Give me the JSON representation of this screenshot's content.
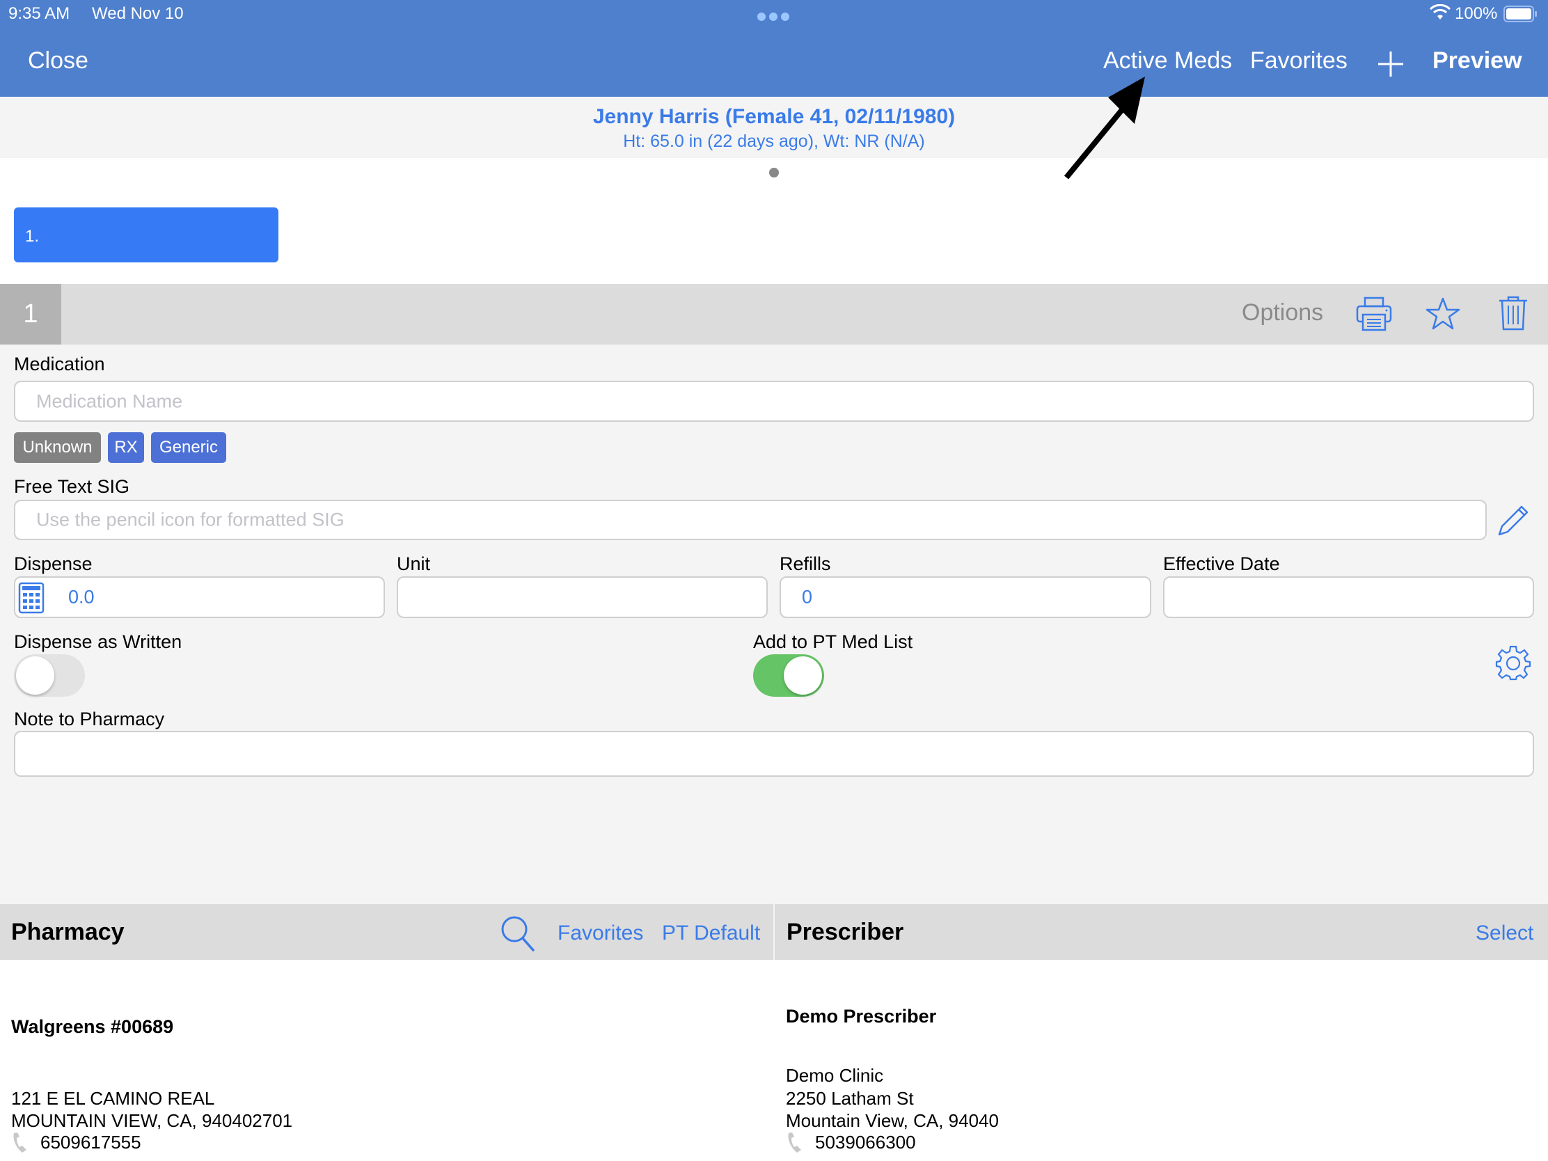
{
  "status_bar": {
    "time": "9:35 AM",
    "date": "Wed Nov 10",
    "battery": "100%"
  },
  "nav": {
    "close_label": "Close",
    "active_meds_label": "Active Meds",
    "favorites_label": "Favorites",
    "add_icon": "plus-icon",
    "preview_label": "Preview"
  },
  "patient": {
    "name_line": "Jenny Harris (Female 41, 02/11/1980)",
    "vitals_line": "Ht: 65.0 in (22 days ago), Wt: NR  (N/A)"
  },
  "rx_tab": {
    "label": "1."
  },
  "section": {
    "number": "1",
    "options_label": "Options",
    "icons": [
      "printer-icon",
      "star-icon",
      "trash-icon"
    ]
  },
  "form": {
    "medication_label": "Medication",
    "medication_placeholder": "Medication Name",
    "medication_value": "",
    "badges": [
      {
        "label": "Unknown",
        "color": "#828282"
      },
      {
        "label": "RX",
        "color": "#4c70d6"
      },
      {
        "label": "Generic",
        "color": "#4c70d6"
      }
    ],
    "sig_label": "Free Text SIG",
    "sig_placeholder": "Use the pencil icon for formatted SIG",
    "sig_value": "",
    "dispense_label": "Dispense",
    "dispense_value": "0.0",
    "unit_label": "Unit",
    "unit_value": "",
    "refills_label": "Refills",
    "refills_value": "0",
    "effective_date_label": "Effective Date",
    "effective_date_value": "",
    "daw_label": "Dispense as Written",
    "daw_on": false,
    "add_med_list_label": "Add to PT Med List",
    "add_med_list_on": true,
    "note_label": "Note to Pharmacy",
    "note_value": ""
  },
  "pharmacy": {
    "title": "Pharmacy",
    "favorites_label": "Favorites",
    "pt_default_label": "PT Default",
    "name": "Walgreens #00689",
    "address1": "121 E EL CAMINO REAL",
    "address2": "MOUNTAIN VIEW, CA, 940402701",
    "phone": "6509617555"
  },
  "prescriber": {
    "title": "Prescriber",
    "select_label": "Select",
    "name": "Demo Prescriber",
    "clinic": "Demo Clinic",
    "address1": "2250 Latham St",
    "address2": "Mountain View, CA, 94040",
    "phone": "5039066300"
  },
  "colors": {
    "nav_bar": "#4f80ce",
    "accent": "#3a7be8",
    "tab_blue": "#367af5",
    "toggle_on": "#65c466"
  }
}
